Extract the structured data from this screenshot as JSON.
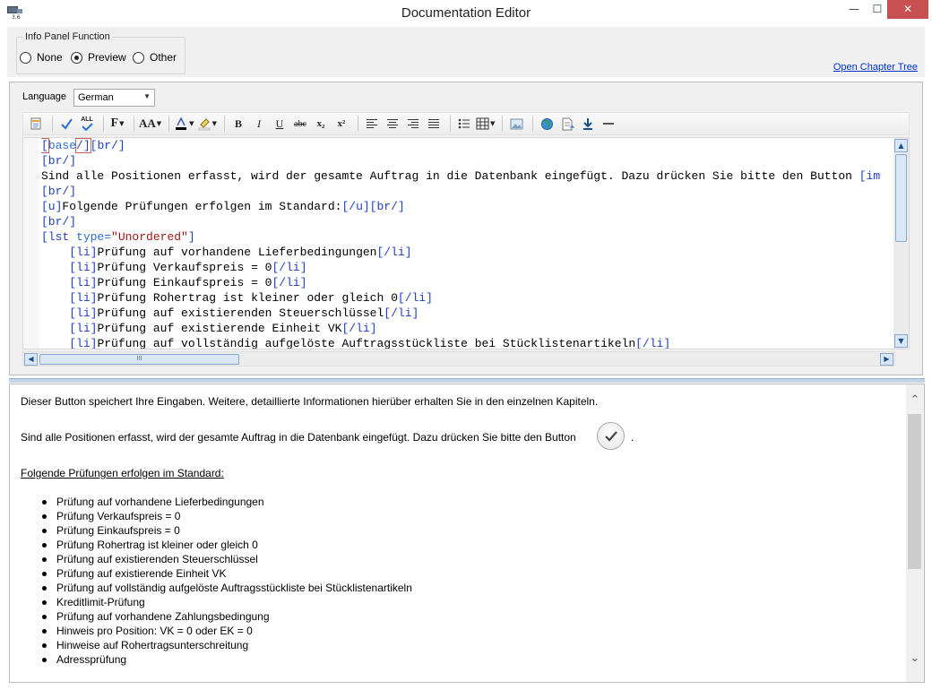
{
  "window": {
    "title": "Documentation Editor",
    "icon": "app-screen-icon",
    "icon_version": "3.6",
    "min_glyph": "—",
    "max_glyph": "☐",
    "close_glyph": "✕"
  },
  "info_panel": {
    "group_title": "Info Panel Function",
    "options": [
      {
        "label": "None",
        "checked": false
      },
      {
        "label": "Preview",
        "checked": true
      },
      {
        "label": "Other",
        "checked": false
      }
    ],
    "open_chapter_tree": "Open Chapter Tree"
  },
  "editor": {
    "language_label": "Language",
    "language_value": "German",
    "toolbar": {
      "bold": "B",
      "italic": "I",
      "underline": "U",
      "strike": "abc",
      "subscript": "x₂",
      "superscript": "x²",
      "font": "F",
      "size": "AA",
      "spellcheck_all": "ALL"
    },
    "hscroll_grip": "III",
    "code_lines": [
      [
        {
          "t": "[",
          "c": "tag"
        },
        {
          "t": "base",
          "c": "kw"
        },
        {
          "t": "/]",
          "c": "tag"
        },
        {
          "t": "[br/]",
          "c": "tag"
        }
      ],
      [
        {
          "t": "[br/]",
          "c": "tag"
        }
      ],
      [
        {
          "t": "Sind alle Positionen erfasst, wird der gesamte Auftrag in die Datenbank eingefügt. Dazu drücken Sie bitte den Button ",
          "c": ""
        },
        {
          "t": "[im",
          "c": "tag"
        }
      ],
      [
        {
          "t": "[br/]",
          "c": "tag"
        }
      ],
      [
        {
          "t": "[u]",
          "c": "tag"
        },
        {
          "t": "Folgende Prüfungen erfolgen im Standard:",
          "c": ""
        },
        {
          "t": "[/u][br/]",
          "c": "tag"
        }
      ],
      [
        {
          "t": "[br/]",
          "c": "tag"
        }
      ],
      [
        {
          "t": "[lst ",
          "c": "tag"
        },
        {
          "t": "type=",
          "c": "kw"
        },
        {
          "t": "\"Unordered\"",
          "c": "str"
        },
        {
          "t": "]",
          "c": "tag"
        }
      ],
      [
        {
          "t": "    ",
          "c": ""
        },
        {
          "t": "[li]",
          "c": "tag"
        },
        {
          "t": "Prüfung auf vorhandene Lieferbedingungen",
          "c": ""
        },
        {
          "t": "[/li]",
          "c": "tag"
        }
      ],
      [
        {
          "t": "    ",
          "c": ""
        },
        {
          "t": "[li]",
          "c": "tag"
        },
        {
          "t": "Prüfung Verkaufspreis = 0",
          "c": ""
        },
        {
          "t": "[/li]",
          "c": "tag"
        }
      ],
      [
        {
          "t": "    ",
          "c": ""
        },
        {
          "t": "[li]",
          "c": "tag"
        },
        {
          "t": "Prüfung Einkaufspreis = 0",
          "c": ""
        },
        {
          "t": "[/li]",
          "c": "tag"
        }
      ],
      [
        {
          "t": "    ",
          "c": ""
        },
        {
          "t": "[li]",
          "c": "tag"
        },
        {
          "t": "Prüfung Rohertrag ist kleiner oder gleich 0",
          "c": ""
        },
        {
          "t": "[/li]",
          "c": "tag"
        }
      ],
      [
        {
          "t": "    ",
          "c": ""
        },
        {
          "t": "[li]",
          "c": "tag"
        },
        {
          "t": "Prüfung auf existierenden Steuerschlüssel",
          "c": ""
        },
        {
          "t": "[/li]",
          "c": "tag"
        }
      ],
      [
        {
          "t": "    ",
          "c": ""
        },
        {
          "t": "[li]",
          "c": "tag"
        },
        {
          "t": "Prüfung auf existierende Einheit VK",
          "c": ""
        },
        {
          "t": "[/li]",
          "c": "tag"
        }
      ],
      [
        {
          "t": "    ",
          "c": ""
        },
        {
          "t": "[li]",
          "c": "tag"
        },
        {
          "t": "Prüfung auf vollständig aufgelöste Auftragsstückliste bei Stücklistenartikeln",
          "c": ""
        },
        {
          "t": "[/li]",
          "c": "tag"
        }
      ]
    ]
  },
  "preview": {
    "line1": "Dieser Button speichert Ihre Eingaben. Weitere, detaillierte Informationen hierüber erhalten Sie in den einzelnen Kapiteln.",
    "line2": "Sind alle Positionen erfasst, wird der gesamte Auftrag in die Datenbank eingefügt. Dazu drücken Sie bitte den Button",
    "line2_end": ".",
    "heading": "Folgende Prüfungen erfolgen im Standard:",
    "list": [
      "Prüfung auf vorhandene Lieferbedingungen",
      "Prüfung Verkaufspreis = 0",
      "Prüfung Einkaufspreis = 0",
      "Prüfung Rohertrag ist kleiner oder gleich 0",
      "Prüfung auf existierenden Steuerschlüssel",
      "Prüfung auf existierende Einheit VK",
      "Prüfung auf vollständig aufgelöste Auftragsstückliste bei Stücklistenartikeln",
      "Kreditlimit-Prüfung",
      "Prüfung auf vorhandene Zahlungsbedingung",
      "Hinweis pro Position: VK = 0 oder EK = 0",
      "Hinweise auf Rohertragsunterschreitung",
      "Adressprüfung"
    ]
  },
  "colors": {
    "tag": "#1f3fbf",
    "keyword": "#2a6fcf",
    "string": "#a31515",
    "close_button": "#c75050",
    "link": "#0033cc"
  }
}
